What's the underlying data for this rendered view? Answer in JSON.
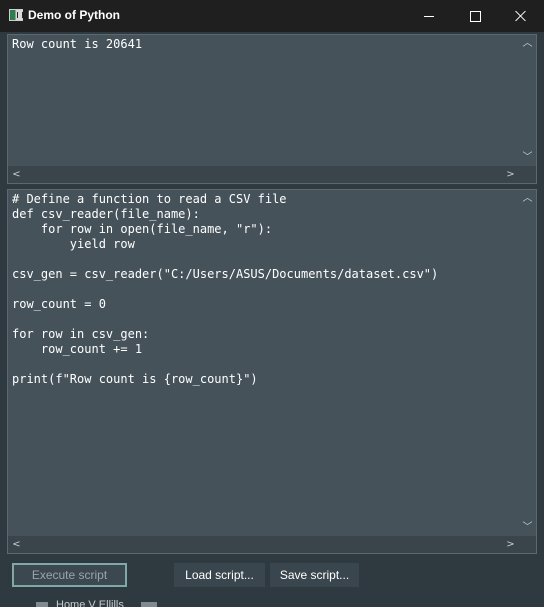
{
  "window": {
    "title": "Demo of Python"
  },
  "output": {
    "text": "Row count is 20641"
  },
  "editor": {
    "code": "# Define a function to read a CSV file\ndef csv_reader(file_name):\n    for row in open(file_name, \"r\"):\n        yield row\n\ncsv_gen = csv_reader(\"C:/Users/ASUS/Documents/dataset.csv\")\n\nrow_count = 0\n\nfor row in csv_gen:\n    row_count += 1\n\nprint(f\"Row count is {row_count}\")"
  },
  "buttons": {
    "execute": "Execute script",
    "load": "Load script...",
    "save": "Save script..."
  },
  "scroll_glyphs": {
    "up": "︿",
    "down": "﹀",
    "left": "<",
    "right": ">"
  },
  "background_peek": {
    "text": "Home V Ellills"
  },
  "colors": {
    "titlebar": "#1f1f1f",
    "panel": "#45525a",
    "window": "#2f3a40",
    "execute_border": "#7fa8a6"
  }
}
